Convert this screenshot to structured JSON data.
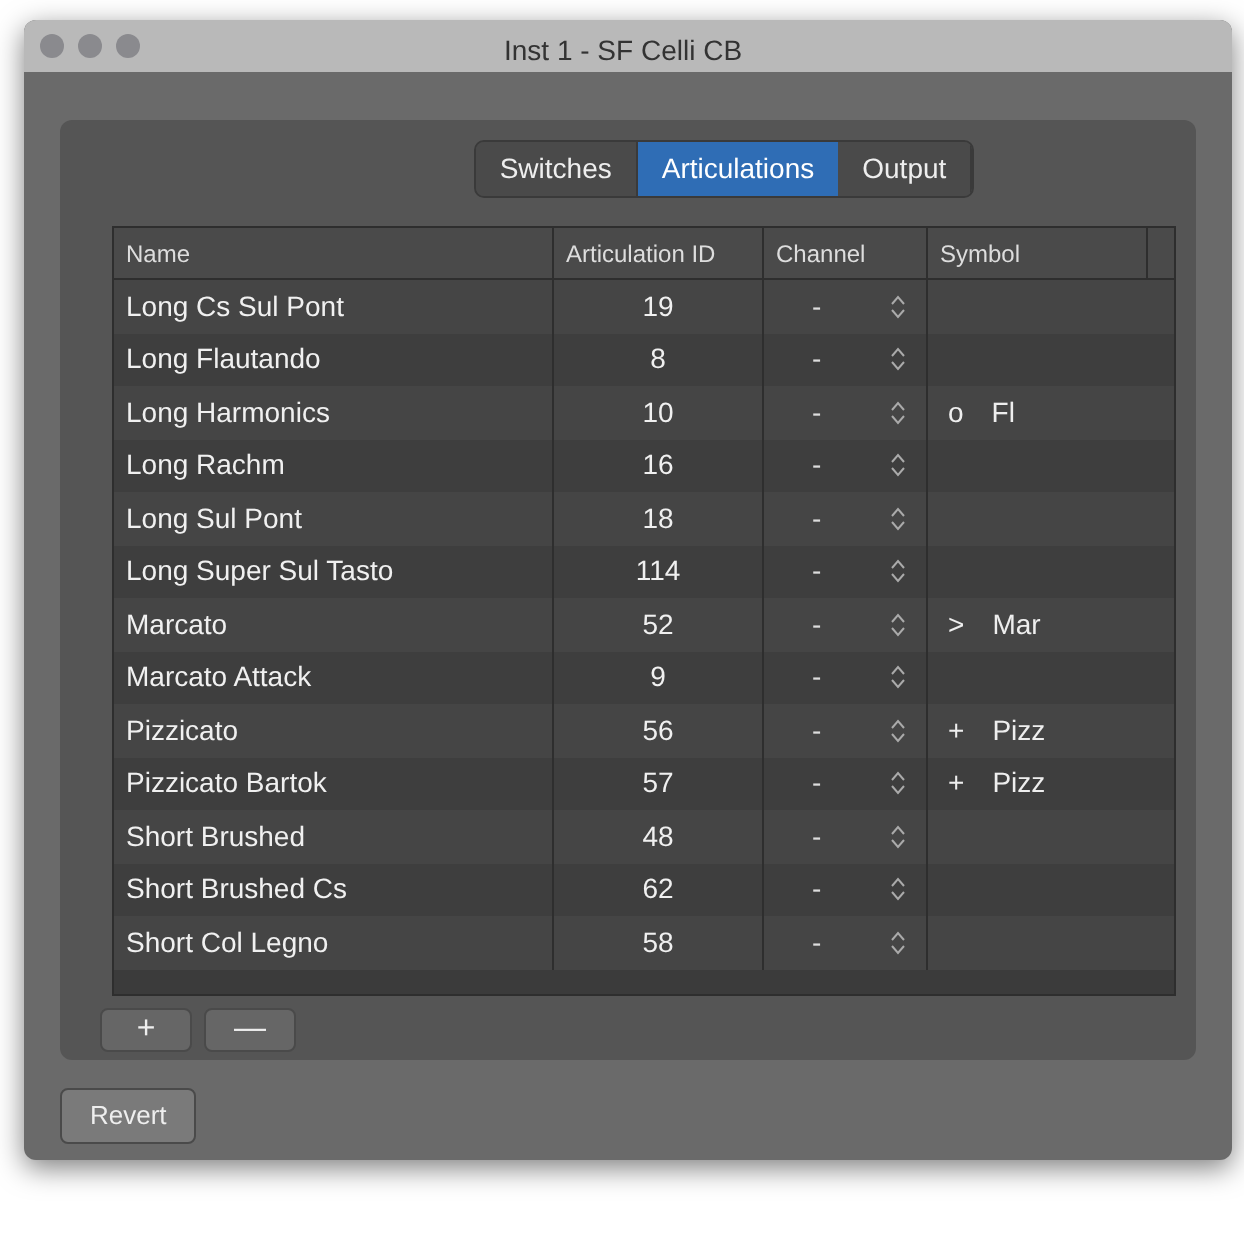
{
  "window": {
    "title": "Inst 1 - SF Celli CB"
  },
  "tabs": [
    {
      "label": "Switches",
      "selected": false
    },
    {
      "label": "Articulations",
      "selected": true
    },
    {
      "label": "Output",
      "selected": false
    }
  ],
  "table": {
    "columns": [
      "Name",
      "Articulation ID",
      "Channel",
      "Symbol"
    ],
    "rows": [
      {
        "name": "Long Cs Sul Pont",
        "id": "19",
        "channel": "-"
      },
      {
        "name": "Long Flautando",
        "id": "8",
        "channel": "-"
      },
      {
        "name": "Long Harmonics",
        "id": "10",
        "channel": "-",
        "symbol_mark": "o",
        "symbol": "Fl"
      },
      {
        "name": "Long Rachm",
        "id": "16",
        "channel": "-"
      },
      {
        "name": "Long Sul Pont",
        "id": "18",
        "channel": "-"
      },
      {
        "name": "Long Super Sul Tasto",
        "id": "114",
        "channel": "-"
      },
      {
        "name": "Marcato",
        "id": "52",
        "channel": "-",
        "symbol_mark": ">",
        "symbol": "Mar"
      },
      {
        "name": "Marcato Attack",
        "id": "9",
        "channel": "-"
      },
      {
        "name": "Pizzicato",
        "id": "56",
        "channel": "-",
        "symbol_mark": "+",
        "symbol": "Pizz"
      },
      {
        "name": "Pizzicato Bartok",
        "id": "57",
        "channel": "-",
        "symbol_mark": "+",
        "symbol": "Pizz"
      },
      {
        "name": "Short Brushed",
        "id": "48",
        "channel": "-"
      },
      {
        "name": "Short Brushed Cs",
        "id": "62",
        "channel": "-"
      },
      {
        "name": "Short Col Legno",
        "id": "58",
        "channel": "-"
      }
    ]
  },
  "list_buttons": [
    "+",
    "—"
  ],
  "footer_button": "Revert"
}
